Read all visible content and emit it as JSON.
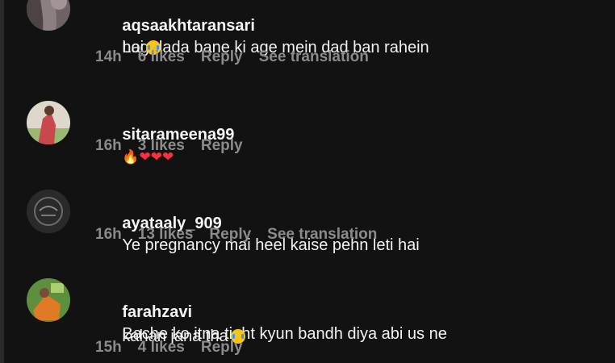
{
  "comments": [
    {
      "username": "aqsaakhtaransari",
      "text": "Log dada bane ki age mein dad ban rahein",
      "text_line2": "hai",
      "emoji": "😂",
      "time": "14h",
      "likes": "6 likes",
      "reply_label": "Reply",
      "translation_label": "See translation",
      "avatar_color": "#5a4a49"
    },
    {
      "username": "sitarameena99",
      "text": "🔥❤️❤️❤️",
      "time": "16h",
      "likes": "3 likes",
      "reply_label": "Reply",
      "avatar_color": "#d8e7d0"
    },
    {
      "username": "ayataaly_909",
      "text": "Ye pregnancy mai heel kaise pehn leti hai",
      "time": "16h",
      "likes": "13 likes",
      "reply_label": "Reply",
      "translation_label": "See translation",
      "avatar_color": "#2b2b2b"
    },
    {
      "username": "farahzavi",
      "text": "Bache ko itna tight kyun bandh diya abi us ne",
      "text_line2": "kahan jana tha",
      "emoji": "😂",
      "time": "15h",
      "likes": "4 likes",
      "reply_label": "Reply",
      "avatar_color": "#8bc94a"
    }
  ],
  "colors": {
    "background": "#121212",
    "text": "#f2f2f2",
    "meta": "#8b8b8b",
    "heart": "#ff2d3f",
    "fire": "#ff7a1a"
  }
}
